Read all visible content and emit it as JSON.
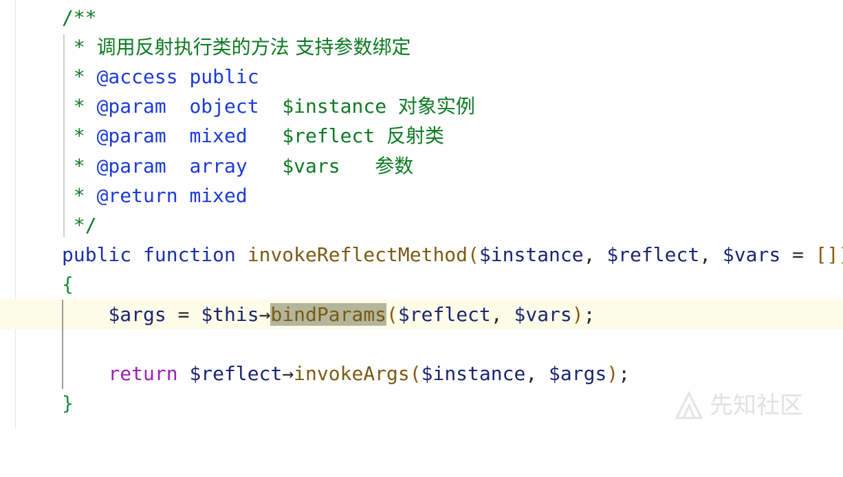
{
  "code": {
    "lines": [
      [
        "/**"
      ],
      [
        " * ",
        "调用反射执行类的方法 支持参数绑定"
      ],
      [
        " * ",
        "@access",
        " ",
        "public"
      ],
      [
        " * ",
        "@param",
        "  ",
        "object",
        "  ",
        "$instance",
        " ",
        "对象实例"
      ],
      [
        " * ",
        "@param",
        "  ",
        "mixed",
        "   ",
        "$reflect",
        " ",
        "反射类"
      ],
      [
        " * ",
        "@param",
        "  ",
        "array",
        "   ",
        "$vars",
        "   ",
        "参数"
      ],
      [
        " * ",
        "@return",
        " ",
        "mixed"
      ],
      [
        " */"
      ],
      [
        "public",
        " ",
        "function",
        " ",
        "invokeReflectMethod",
        "(",
        "$instance",
        ", ",
        "$reflect",
        ", ",
        "$vars",
        " = ",
        "[]",
        ")"
      ],
      [
        "{"
      ],
      [
        "    ",
        "$args",
        " = ",
        "$this",
        "→",
        "bindParams",
        "(",
        "$reflect",
        ", ",
        "$vars",
        ")",
        ";"
      ],
      [
        ""
      ],
      [
        "    ",
        "return",
        " ",
        "$reflect",
        "→",
        "invokeArgs",
        "(",
        "$instance",
        ", ",
        "$args",
        ")",
        ";"
      ],
      [
        "}"
      ]
    ]
  },
  "watermark": {
    "text": "先知社区"
  }
}
